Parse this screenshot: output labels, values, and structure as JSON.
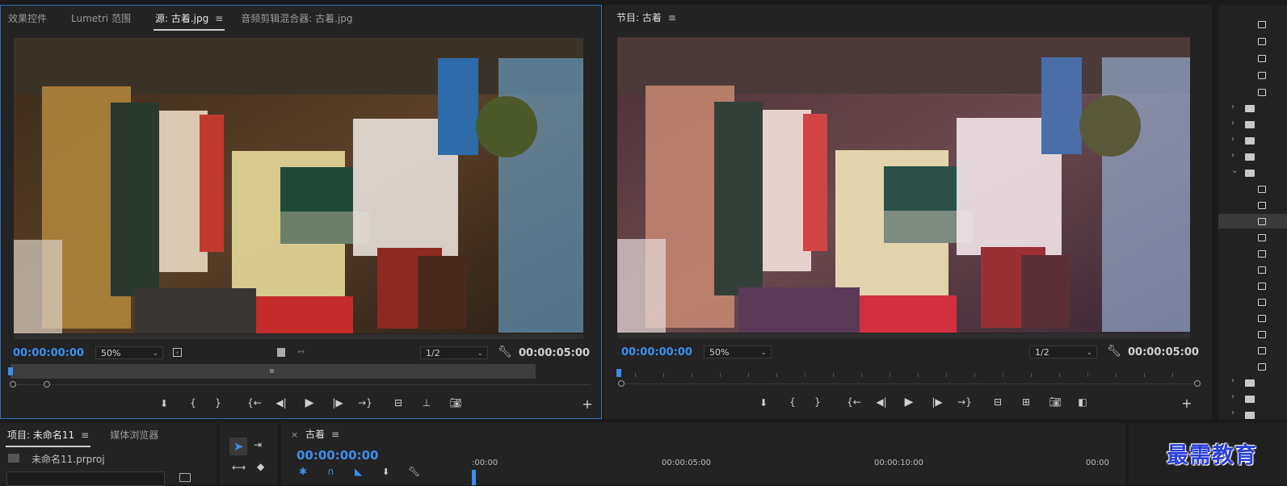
{
  "source_monitor": {
    "tabs": [
      {
        "label": "效果控件"
      },
      {
        "label": "Lumetri 范围"
      },
      {
        "label": "源: 古着.jpg"
      },
      {
        "label": "音频剪辑混合器: 古着.jpg"
      }
    ],
    "timecode_in": "00:00:00:00",
    "zoom": "50%",
    "resolution": "1/2",
    "duration": "00:00:05:00"
  },
  "program_monitor": {
    "title": "节目: 古着",
    "timecode_in": "00:00:00:00",
    "zoom": "50%",
    "resolution": "1/2",
    "duration": "00:00:05:00"
  },
  "project_panel": {
    "tabs": [
      {
        "label": "项目: 未命名11"
      },
      {
        "label": "媒体浏览器"
      }
    ],
    "file": "未命名11.prproj"
  },
  "timeline": {
    "sequence": "古着",
    "timecode": "00:00:00:00",
    "ruler": [
      ":00:00",
      "00:00:05:00",
      "00:00:10:00",
      "00:00"
    ]
  },
  "watermark": "最需教育",
  "colors": {
    "accent": "#3d8eea",
    "panel_bg": "#232323",
    "app_bg": "#1b1b1b",
    "watermark": "#2a3fd6"
  }
}
